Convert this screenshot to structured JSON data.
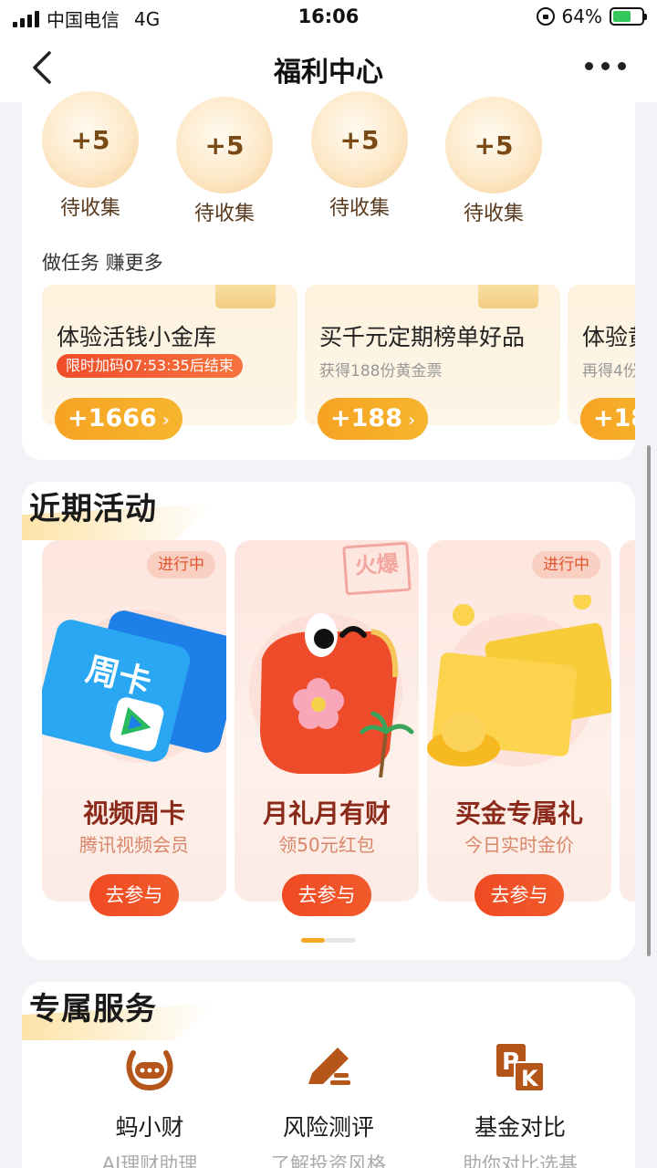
{
  "status_bar": {
    "carrier": "中国电信",
    "network": "4G",
    "time": "16:06",
    "battery": "64%"
  },
  "nav": {
    "title": "福利中心"
  },
  "coins": [
    {
      "amount": "+5",
      "label": "待收集"
    },
    {
      "amount": "+5",
      "label": "待收集"
    },
    {
      "amount": "+5",
      "label": "待收集"
    },
    {
      "amount": "+5",
      "label": "待收集"
    }
  ],
  "tasks_section": {
    "title": "做任务 赚更多",
    "items": [
      {
        "title": "体验活钱小金库",
        "badge": "限时加码07:53:35后结束",
        "button": "+1666"
      },
      {
        "title": "买千元定期榜单好品",
        "desc": "获得188份黄金票",
        "button": "+188"
      },
      {
        "title": "体验黄",
        "desc": "再得4份",
        "button": "+18"
      }
    ]
  },
  "activities": {
    "title": "近期活动",
    "items": [
      {
        "status": "进行中",
        "title": "视频周卡",
        "subtitle": "腾讯视频会员",
        "button": "去参与",
        "art_text": "周卡"
      },
      {
        "stamp": "火爆",
        "title": "月礼月有财",
        "subtitle": "领50元红包",
        "button": "去参与"
      },
      {
        "status": "进行中",
        "title": "买金专属礼",
        "subtitle": "今日实时金价",
        "button": "去参与"
      }
    ]
  },
  "services": {
    "title": "专属服务",
    "items": [
      {
        "name": "蚂小财",
        "desc": "AI理财助理",
        "icon": "ai-assistant-icon"
      },
      {
        "name": "风险测评",
        "desc": "了解投资风格",
        "icon": "pen-edit-icon"
      },
      {
        "name": "基金对比",
        "desc": "助你对比选基",
        "icon": "pk-icon"
      }
    ]
  },
  "colors": {
    "accent_orange": "#f6a623",
    "accent_red": "#f04a22",
    "icon_brown": "#b4561a"
  }
}
